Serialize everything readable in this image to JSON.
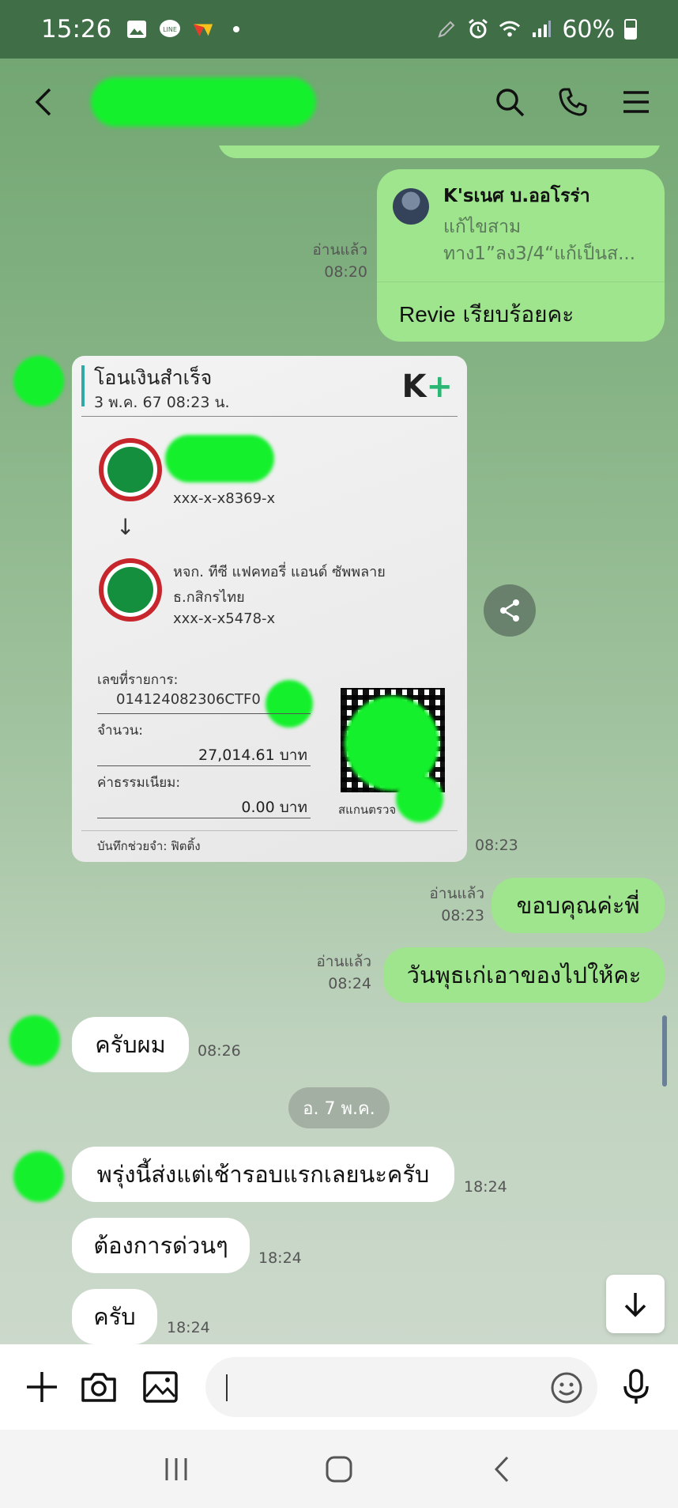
{
  "status_bar": {
    "time": "15:26",
    "battery": "60%"
  },
  "chat": {
    "reply_card": {
      "quoted_name": "K'sเนศ บ.ออโรร่า",
      "quoted_line1": "แก้ไขสาม",
      "quoted_line2": "ทาง1”ลง3/4“แก้เป็นส...",
      "read_label": "อ่านแล้ว",
      "time": "08:20",
      "brand": "Revie",
      "body": "เรียบร้อยคะ"
    },
    "slip": {
      "title": "โอนเงินสำเร็จ",
      "date": "3 พ.ค. 67  08:23 น.",
      "logo_k": "K",
      "logo_plus": "+",
      "from_account": "xxx-x-x8369-x",
      "to_name": "หจก. ทีซี แฟคทอรี่ แอนด์ ซัพพลาย",
      "to_bank": "ธ.กสิกรไทย",
      "to_account": "xxx-x-x5478-x",
      "ref_label": "เลขที่รายการ:",
      "ref_value": "014124082306CTF0",
      "amount_label": "จำนวน:",
      "amount_value": "27,014.61 บาท",
      "fee_label": "ค่าธรรมเนียม:",
      "fee_value": "0.00 บาท",
      "scan_label": "สแกนตรวจ",
      "memo": "บันทึกช่วยจำ: ฟิตติ้ง",
      "time": "08:23"
    },
    "messages": [
      {
        "read": "อ่านแล้ว",
        "time": "08:23",
        "text": "ขอบคุณค่ะพี่"
      },
      {
        "read": "อ่านแล้ว",
        "time": "08:24",
        "text": "วันพุธเก่เอาของไปให้คะ"
      },
      {
        "time": "08:26",
        "text": "ครับผม"
      },
      {
        "time": "18:24",
        "text": "พรุ่งนี้ส่งแต่เช้ารอบแรกเลยนะครับ"
      },
      {
        "time": "18:24",
        "text": "ต้องการด่วนๆ"
      },
      {
        "time": "18:24",
        "text": "ครับ"
      }
    ],
    "date_separator": "อ. 7 พ.ค."
  },
  "icons": [
    "back-icon",
    "search-icon",
    "phone-icon",
    "menu-icon",
    "share-icon",
    "arrow-down-icon",
    "plus-icon",
    "camera-icon",
    "image-icon",
    "emoji-icon",
    "mic-icon"
  ]
}
